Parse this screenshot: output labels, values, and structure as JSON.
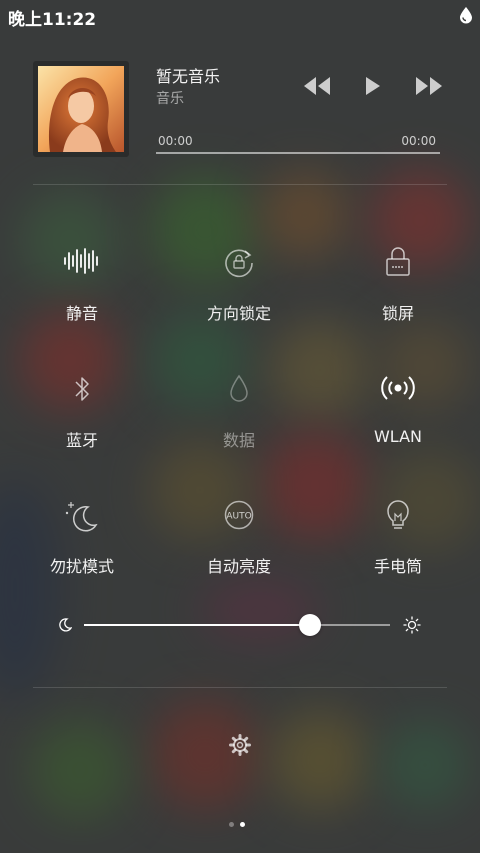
{
  "status_bar": {
    "time": "晚上11:22",
    "icon": "water-drop-icon"
  },
  "music": {
    "title": "暂无音乐",
    "subtitle": "音乐",
    "time_elapsed": "00:00",
    "time_total": "00:00",
    "progress": 0,
    "controls": [
      "rewind-icon",
      "play-icon",
      "fast-forward-icon"
    ]
  },
  "toggles": [
    {
      "label": "静音",
      "icon": "sound-wave-icon",
      "active": true
    },
    {
      "label": "方向锁定",
      "icon": "rotation-lock-icon",
      "active": false
    },
    {
      "label": "锁屏",
      "icon": "lock-icon",
      "active": true
    },
    {
      "label": "蓝牙",
      "icon": "bluetooth-icon",
      "active": true
    },
    {
      "label": "数据",
      "icon": "data-drop-icon",
      "active": false
    },
    {
      "label": "WLAN",
      "icon": "wifi-icon",
      "active": true
    },
    {
      "label": "勿扰模式",
      "icon": "moon-icon",
      "active": true
    },
    {
      "label": "自动亮度",
      "icon": "auto-brightness-icon",
      "active": true
    },
    {
      "label": "手电筒",
      "icon": "bulb-icon",
      "active": true
    }
  ],
  "brightness": {
    "level": 0.74,
    "min_icon": "moon-small-icon",
    "max_icon": "sun-icon"
  },
  "settings_icon": "gear-icon",
  "page_indicator": {
    "pages": 2,
    "current": 2
  },
  "colors": {
    "text": "#ffffff",
    "dim_text": "#8c8e8d",
    "background": "#3d3f3e"
  }
}
